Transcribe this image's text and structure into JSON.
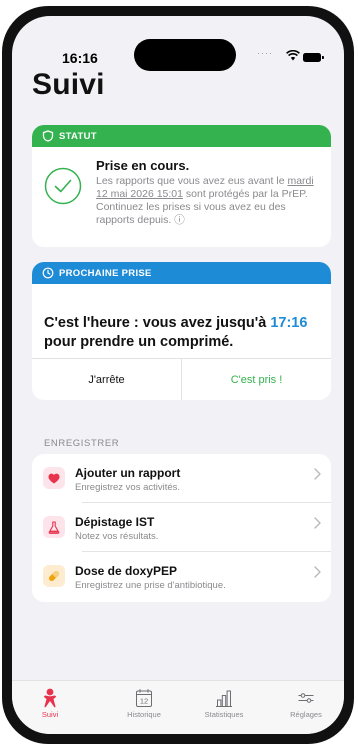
{
  "status_bar": {
    "time": "16:16"
  },
  "page": {
    "title": "Suivi"
  },
  "status_card": {
    "header": "STATUT",
    "title": "Prise en cours.",
    "desc_before": "Les rapports que vous avez eus avant le ",
    "desc_date": "mardi 12 mai 2026 15:01",
    "desc_after": " sont protégés par la PrEP. Continuez les prises si vous avez eu des rapports depuis. ⓘ"
  },
  "next_card": {
    "header": "PROCHAINE PRISE",
    "text_before": "C'est l'heure : vous avez jusqu'à ",
    "hour": "17:16",
    "text_after": " pour prendre un comprimé.",
    "stop_label": "J'arrête",
    "taken_label": "C'est pris !"
  },
  "log_section": {
    "label": "ENREGISTRER",
    "items": [
      {
        "title": "Ajouter un rapport",
        "subtitle": "Enregistrez vos activités.",
        "icon": "heart-icon"
      },
      {
        "title": "Dépistage IST",
        "subtitle": "Notez vos résultats.",
        "icon": "flask-icon"
      },
      {
        "title": "Dose de doxyPEP",
        "subtitle": "Enregistrez une prise d'antibiotique.",
        "icon": "pill-icon"
      }
    ]
  },
  "tab_bar": {
    "tabs": [
      {
        "label": "Suivi",
        "icon": "person-icon",
        "active": true
      },
      {
        "label": "Historique",
        "icon": "calendar-icon",
        "calendar_day": "12"
      },
      {
        "label": "Statistiques",
        "icon": "chart-icon"
      },
      {
        "label": "Réglages",
        "icon": "sliders-icon"
      }
    ]
  },
  "colors": {
    "green": "#34b24f",
    "blue": "#1e8bd6",
    "red": "#e8334d",
    "gray_text": "#8a8a8e",
    "background": "#f2f2f6"
  }
}
